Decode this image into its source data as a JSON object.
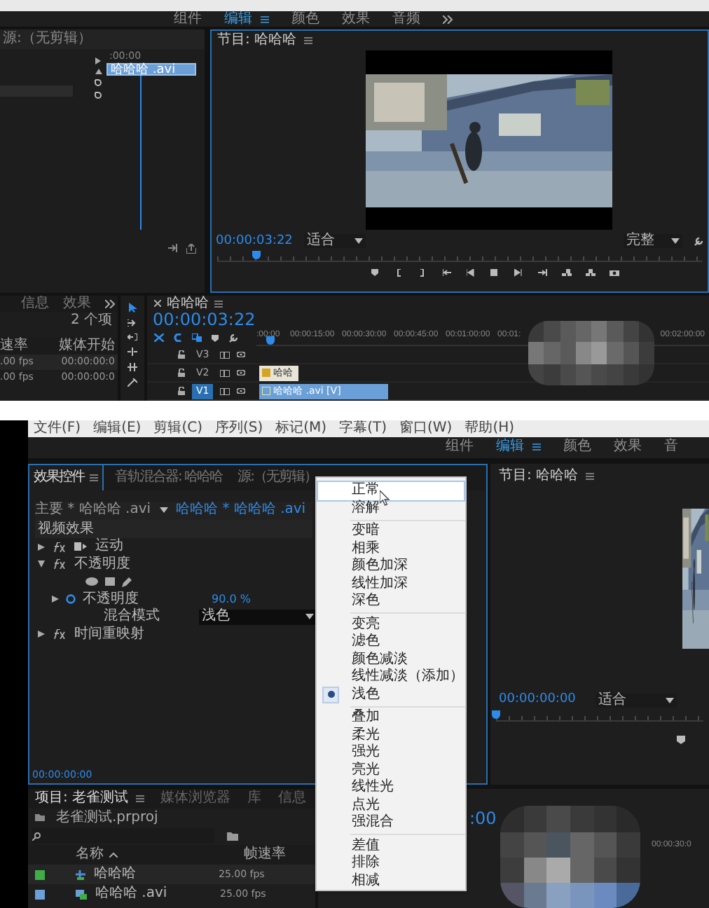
{
  "top_screen": {
    "workspace_tabs": [
      {
        "label": "组件",
        "selected": false
      },
      {
        "label": "编辑",
        "selected": true
      },
      {
        "label": "颜色",
        "selected": false
      },
      {
        "label": "效果",
        "selected": false
      },
      {
        "label": "音频",
        "selected": false
      }
    ],
    "source_panel": {
      "title": "源:（无剪辑）",
      "timecode": ":00:00",
      "clip": "哈哈哈 .avi"
    },
    "program_monitor": {
      "title": "节目: 哈哈哈",
      "timecode": "00:00:03:22",
      "fit": "适合",
      "resolution": "完整",
      "playhead": {
        "level": 0.08
      }
    },
    "project_panel": {
      "tabs": [
        {
          "label": "信息",
          "selected": false
        },
        {
          "label": "效果",
          "selected": false
        }
      ],
      "item_count": "2 个项",
      "columns": [
        "速率",
        "媒体开始"
      ],
      "rows": [
        {
          "rate": ".00 fps",
          "start": "00:00:00:0"
        },
        {
          "rate": ".00 fps",
          "start": "00:00:00:0"
        }
      ]
    },
    "timeline": {
      "title": "哈哈哈",
      "timecode": "00:00:03:22",
      "ruler": [
        ":00:00",
        "00:00:15:00",
        "00:00:30:00",
        "00:00:45:00",
        "00:01:00:00",
        "00:01:"
      ],
      "ruler_end": "00:02:00:00",
      "playhead": {
        "level": 0.03
      },
      "tracks": [
        {
          "name": "V3",
          "selected": false
        },
        {
          "name": "V2",
          "selected": false,
          "clip": "哈哈",
          "kind": "graphic"
        },
        {
          "name": "V1",
          "selected": true,
          "clip": "哈哈哈 .avi [V]",
          "kind": "video"
        }
      ]
    }
  },
  "bottom_screen": {
    "menu": [
      "文件(F)",
      "编辑(E)",
      "剪辑(C)",
      "序列(S)",
      "标记(M)",
      "字幕(T)",
      "窗口(W)",
      "帮助(H)"
    ],
    "workspace_tabs": [
      {
        "label": "组件",
        "selected": false
      },
      {
        "label": "编辑",
        "selected": true
      },
      {
        "label": "颜色",
        "selected": false
      },
      {
        "label": "效果",
        "selected": false
      },
      {
        "label": "音",
        "selected": false
      }
    ],
    "effect_controls": {
      "tabs": [
        {
          "label": "效果控件",
          "selected": true
        },
        {
          "label": "音轨混合器: 哈哈哈",
          "selected": false
        },
        {
          "label": "源:（无剪辑）",
          "selected": false
        }
      ],
      "master": "主要 * 哈哈哈 .avi",
      "sequence": "哈哈哈 * 哈哈哈 .avi",
      "section": "视频效果",
      "effects": [
        {
          "name": "运动",
          "expanded": false
        },
        {
          "name": "不透明度",
          "expanded": true
        },
        {
          "name": "时间重映射",
          "expanded": false
        }
      ],
      "opacity": {
        "label": "不透明度",
        "value": "90.0 %"
      },
      "blend_mode": {
        "label": "混合模式",
        "value": "浅色"
      },
      "timecode": "00:00:00:00"
    },
    "blend_menu": [
      [
        {
          "label": "正常",
          "selected": false,
          "hovered": true
        },
        {
          "label": "溶解",
          "selected": false,
          "hovered": false
        }
      ],
      [
        {
          "label": "变暗",
          "selected": false,
          "hovered": false
        },
        {
          "label": "相乘",
          "selected": false,
          "hovered": false
        },
        {
          "label": "颜色加深",
          "selected": false,
          "hovered": false
        },
        {
          "label": "线性加深",
          "selected": false,
          "hovered": false
        },
        {
          "label": "深色",
          "selected": false,
          "hovered": false
        }
      ],
      [
        {
          "label": "变亮",
          "selected": false,
          "hovered": false
        },
        {
          "label": "滤色",
          "selected": false,
          "hovered": false
        },
        {
          "label": "颜色减淡",
          "selected": false,
          "hovered": false
        },
        {
          "label": "线性减淡（添加）",
          "selected": false,
          "hovered": false
        },
        {
          "label": "浅色",
          "selected": true,
          "hovered": false
        }
      ],
      [
        {
          "label": "叠加",
          "selected": false,
          "hovered": false
        },
        {
          "label": "柔光",
          "selected": false,
          "hovered": false
        },
        {
          "label": "强光",
          "selected": false,
          "hovered": false
        },
        {
          "label": "亮光",
          "selected": false,
          "hovered": false
        },
        {
          "label": "线性光",
          "selected": false,
          "hovered": false
        },
        {
          "label": "点光",
          "selected": false,
          "hovered": false
        },
        {
          "label": "强混合",
          "selected": false,
          "hovered": false
        }
      ],
      [
        {
          "label": "差值",
          "selected": false,
          "hovered": false
        },
        {
          "label": "排除",
          "selected": false,
          "hovered": false
        },
        {
          "label": "相减",
          "selected": false,
          "hovered": false
        }
      ]
    ],
    "program_monitor": {
      "title": "节目: 哈哈哈",
      "timecode": "00:00:00:00",
      "fit": "适合",
      "playhead": {
        "level": 0.0
      }
    },
    "project_panel": {
      "tabs": [
        {
          "label": "项目: 老雀测试",
          "selected": true
        },
        {
          "label": "媒体浏览器",
          "selected": false
        },
        {
          "label": "库",
          "selected": false
        },
        {
          "label": "信息",
          "selected": false
        }
      ],
      "file": "老雀测试.prproj",
      "columns": [
        "名称",
        "帧速率"
      ],
      "rows": [
        {
          "name": "哈哈哈",
          "rate": "25.00 fps",
          "color": "#3fae49",
          "kind": "sequence"
        },
        {
          "name": "哈哈哈 .avi",
          "rate": "25.00 fps",
          "color": "#6a9fd8",
          "kind": "clip"
        }
      ]
    },
    "timeline": {
      "timecode": ":00",
      "ruler": [
        "00:00:30:0"
      ]
    }
  }
}
